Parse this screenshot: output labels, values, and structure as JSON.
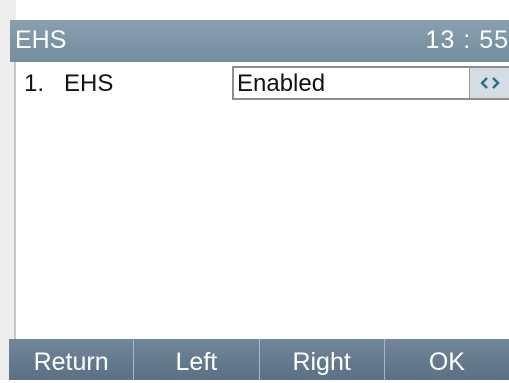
{
  "header": {
    "title": "EHS",
    "time": "13 : 55"
  },
  "setting_row": {
    "index": "1.",
    "label": "EHS",
    "value": "Enabled",
    "switch_icon": "left-right-arrows-icon"
  },
  "softkeys": {
    "return_label": "Return",
    "left_label": "Left",
    "right_label": "Right",
    "ok_label": "OK"
  },
  "colors": {
    "header": "#7c95a5",
    "softkey_bar": "#62788c",
    "arrow_button": "#d5dde4",
    "arrow_glyph": "#2b6a8c"
  }
}
